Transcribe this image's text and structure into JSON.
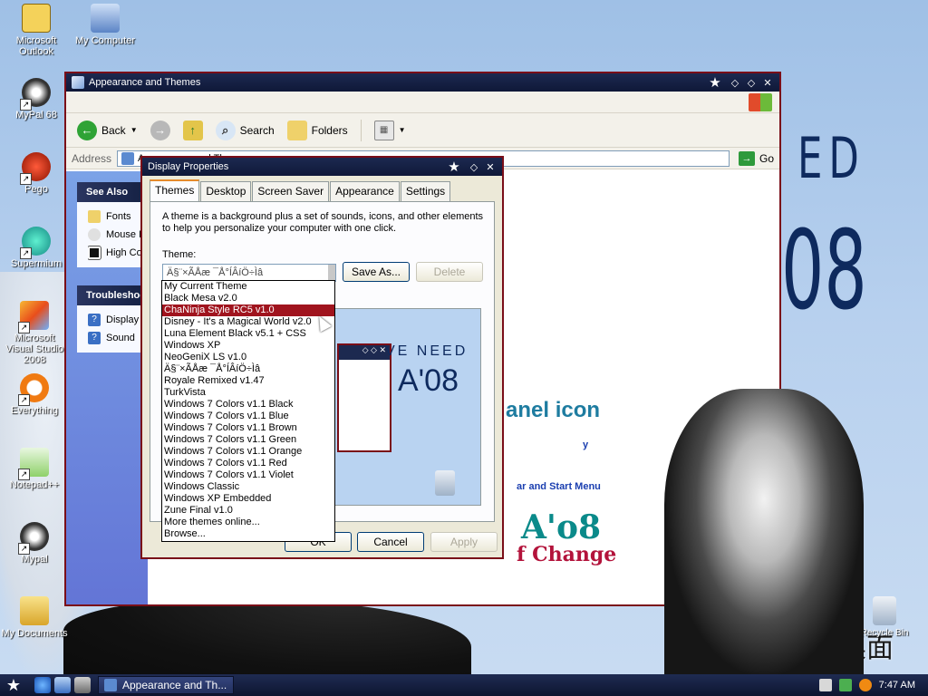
{
  "desktop_icons": [
    {
      "label": "Microsoft Outlook",
      "name": "outlook-desktop-icon"
    },
    {
      "label": "My Computer",
      "name": "my-computer-desktop-icon"
    },
    {
      "label": "MyPal 68",
      "name": "mypal68-desktop-icon"
    },
    {
      "label": "Pego",
      "name": "pego-desktop-icon"
    },
    {
      "label": "Supermium",
      "name": "supermium-desktop-icon"
    },
    {
      "label": "Microsoft Visual Studio 2008",
      "name": "visual-studio-desktop-icon"
    },
    {
      "label": "Everything",
      "name": "everything-desktop-icon"
    },
    {
      "label": "Notepad++",
      "name": "notepadpp-desktop-icon"
    },
    {
      "label": "Mypal",
      "name": "mypal-desktop-icon"
    },
    {
      "label": "My Documents",
      "name": "my-documents-desktop-icon"
    },
    {
      "label": "Recycle Bin",
      "name": "recycle-bin-desktop-icon"
    }
  ],
  "wallpaper": {
    "text_ed": "ED",
    "text_08": "08",
    "logo_text": "魔法桌面"
  },
  "explorer": {
    "title": "Appearance and Themes",
    "toolbar": {
      "back": "Back",
      "search": "Search",
      "folders": "Folders"
    },
    "address_label": "Address",
    "address_value": "Appearance and Themes",
    "go_label": "Go",
    "see_also": {
      "title": "See Also",
      "items": [
        "Fonts",
        "Mouse Pointers",
        "High Contrast"
      ]
    },
    "troubleshooters": {
      "title": "Troubleshooters",
      "items": [
        "Display",
        "Sound"
      ]
    },
    "content": {
      "panel_icon_text": "anel icon",
      "y_text": "y",
      "start_menu_text": "ar and Start Menu",
      "a08_text": "A'o8",
      "change_text": "f Change"
    }
  },
  "dialog": {
    "title": "Display Properties",
    "tabs": [
      "Themes",
      "Desktop",
      "Screen Saver",
      "Appearance",
      "Settings"
    ],
    "description": "A theme is a background plus a set of sounds, icons, and other elements to help you personalize your computer with one click.",
    "theme_label": "Theme:",
    "theme_value": "Ä§¨×ÃÅæ ¯Å°ÍÂíÖ÷Ìâ",
    "save_as": "Save As...",
    "delete": "Delete",
    "ok": "OK",
    "cancel": "Cancel",
    "apply": "Apply",
    "preview_text1": "VE NEED",
    "preview_text2": "A'08",
    "theme_options": [
      "My Current Theme",
      "Black Mesa v2.0",
      "ChaNinja Style RC5 v1.0",
      "Disney - It's a Magical World v2.0",
      "Luna Element Black v5.1 + CSS",
      "Windows XP",
      "NeoGeniX LS v1.0",
      "Ä§¨×ÃÅæ ¯Å°ÍÂíÖ÷Ìâ",
      "Royale Remixed v1.47",
      "TurkVista",
      "Windows 7 Colors v1.1 Black",
      "Windows 7 Colors v1.1 Blue",
      "Windows 7 Colors v1.1 Brown",
      "Windows 7 Colors v1.1 Green",
      "Windows 7 Colors v1.1 Orange",
      "Windows 7 Colors v1.1 Red",
      "Windows 7 Colors v1.1 Violet",
      "Windows Classic",
      "Windows XP Embedded",
      "Zune Final v1.0",
      "More themes online...",
      "Browse..."
    ],
    "selected_index": 2
  },
  "taskbar": {
    "task_label": "Appearance and Th...",
    "clock": "7:47 AM"
  },
  "colors": {
    "accent": "#a0141e",
    "titlebar": "#1c2950",
    "desktop": "#b7d0ee"
  }
}
